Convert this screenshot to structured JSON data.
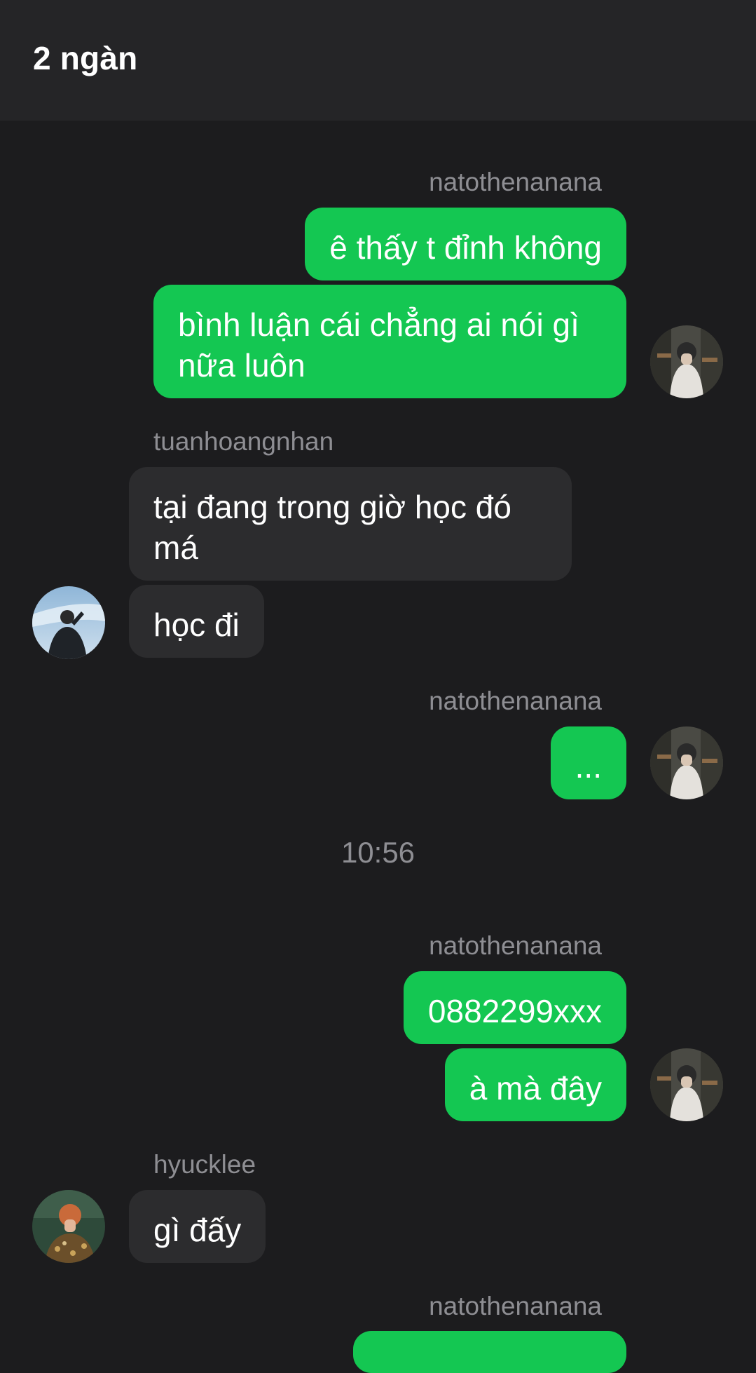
{
  "header": {
    "title": "2 ngàn"
  },
  "messages": {
    "g1": {
      "sender": "natothenanana",
      "m1": "ê thấy t đỉnh không",
      "m2": "bình luận cái chẳng ai nói gì nữa luôn"
    },
    "g2": {
      "sender": "tuanhoangnhan",
      "m1": "tại đang trong giờ học đó má",
      "m2": "học đi"
    },
    "g3": {
      "sender": "natothenanana",
      "m1": "..."
    },
    "timestamp": "10:56",
    "g4": {
      "sender": "natothenanana",
      "m1": "0882299xxx",
      "m2": "à mà đây"
    },
    "g5": {
      "sender": "hyucklee",
      "m1": "gì đấy"
    },
    "g6": {
      "sender": "natothenanana"
    }
  },
  "colors": {
    "background": "#1c1c1e",
    "header": "#252527",
    "outgoing_bubble": "#14c752",
    "incoming_bubble": "#2c2c2e",
    "sender_text": "#8e8e93"
  },
  "icons": {
    "user_avatar": "avatar-natothenanana",
    "tuan_avatar": "avatar-tuanhoangnhan",
    "hyuck_avatar": "avatar-hyucklee"
  }
}
